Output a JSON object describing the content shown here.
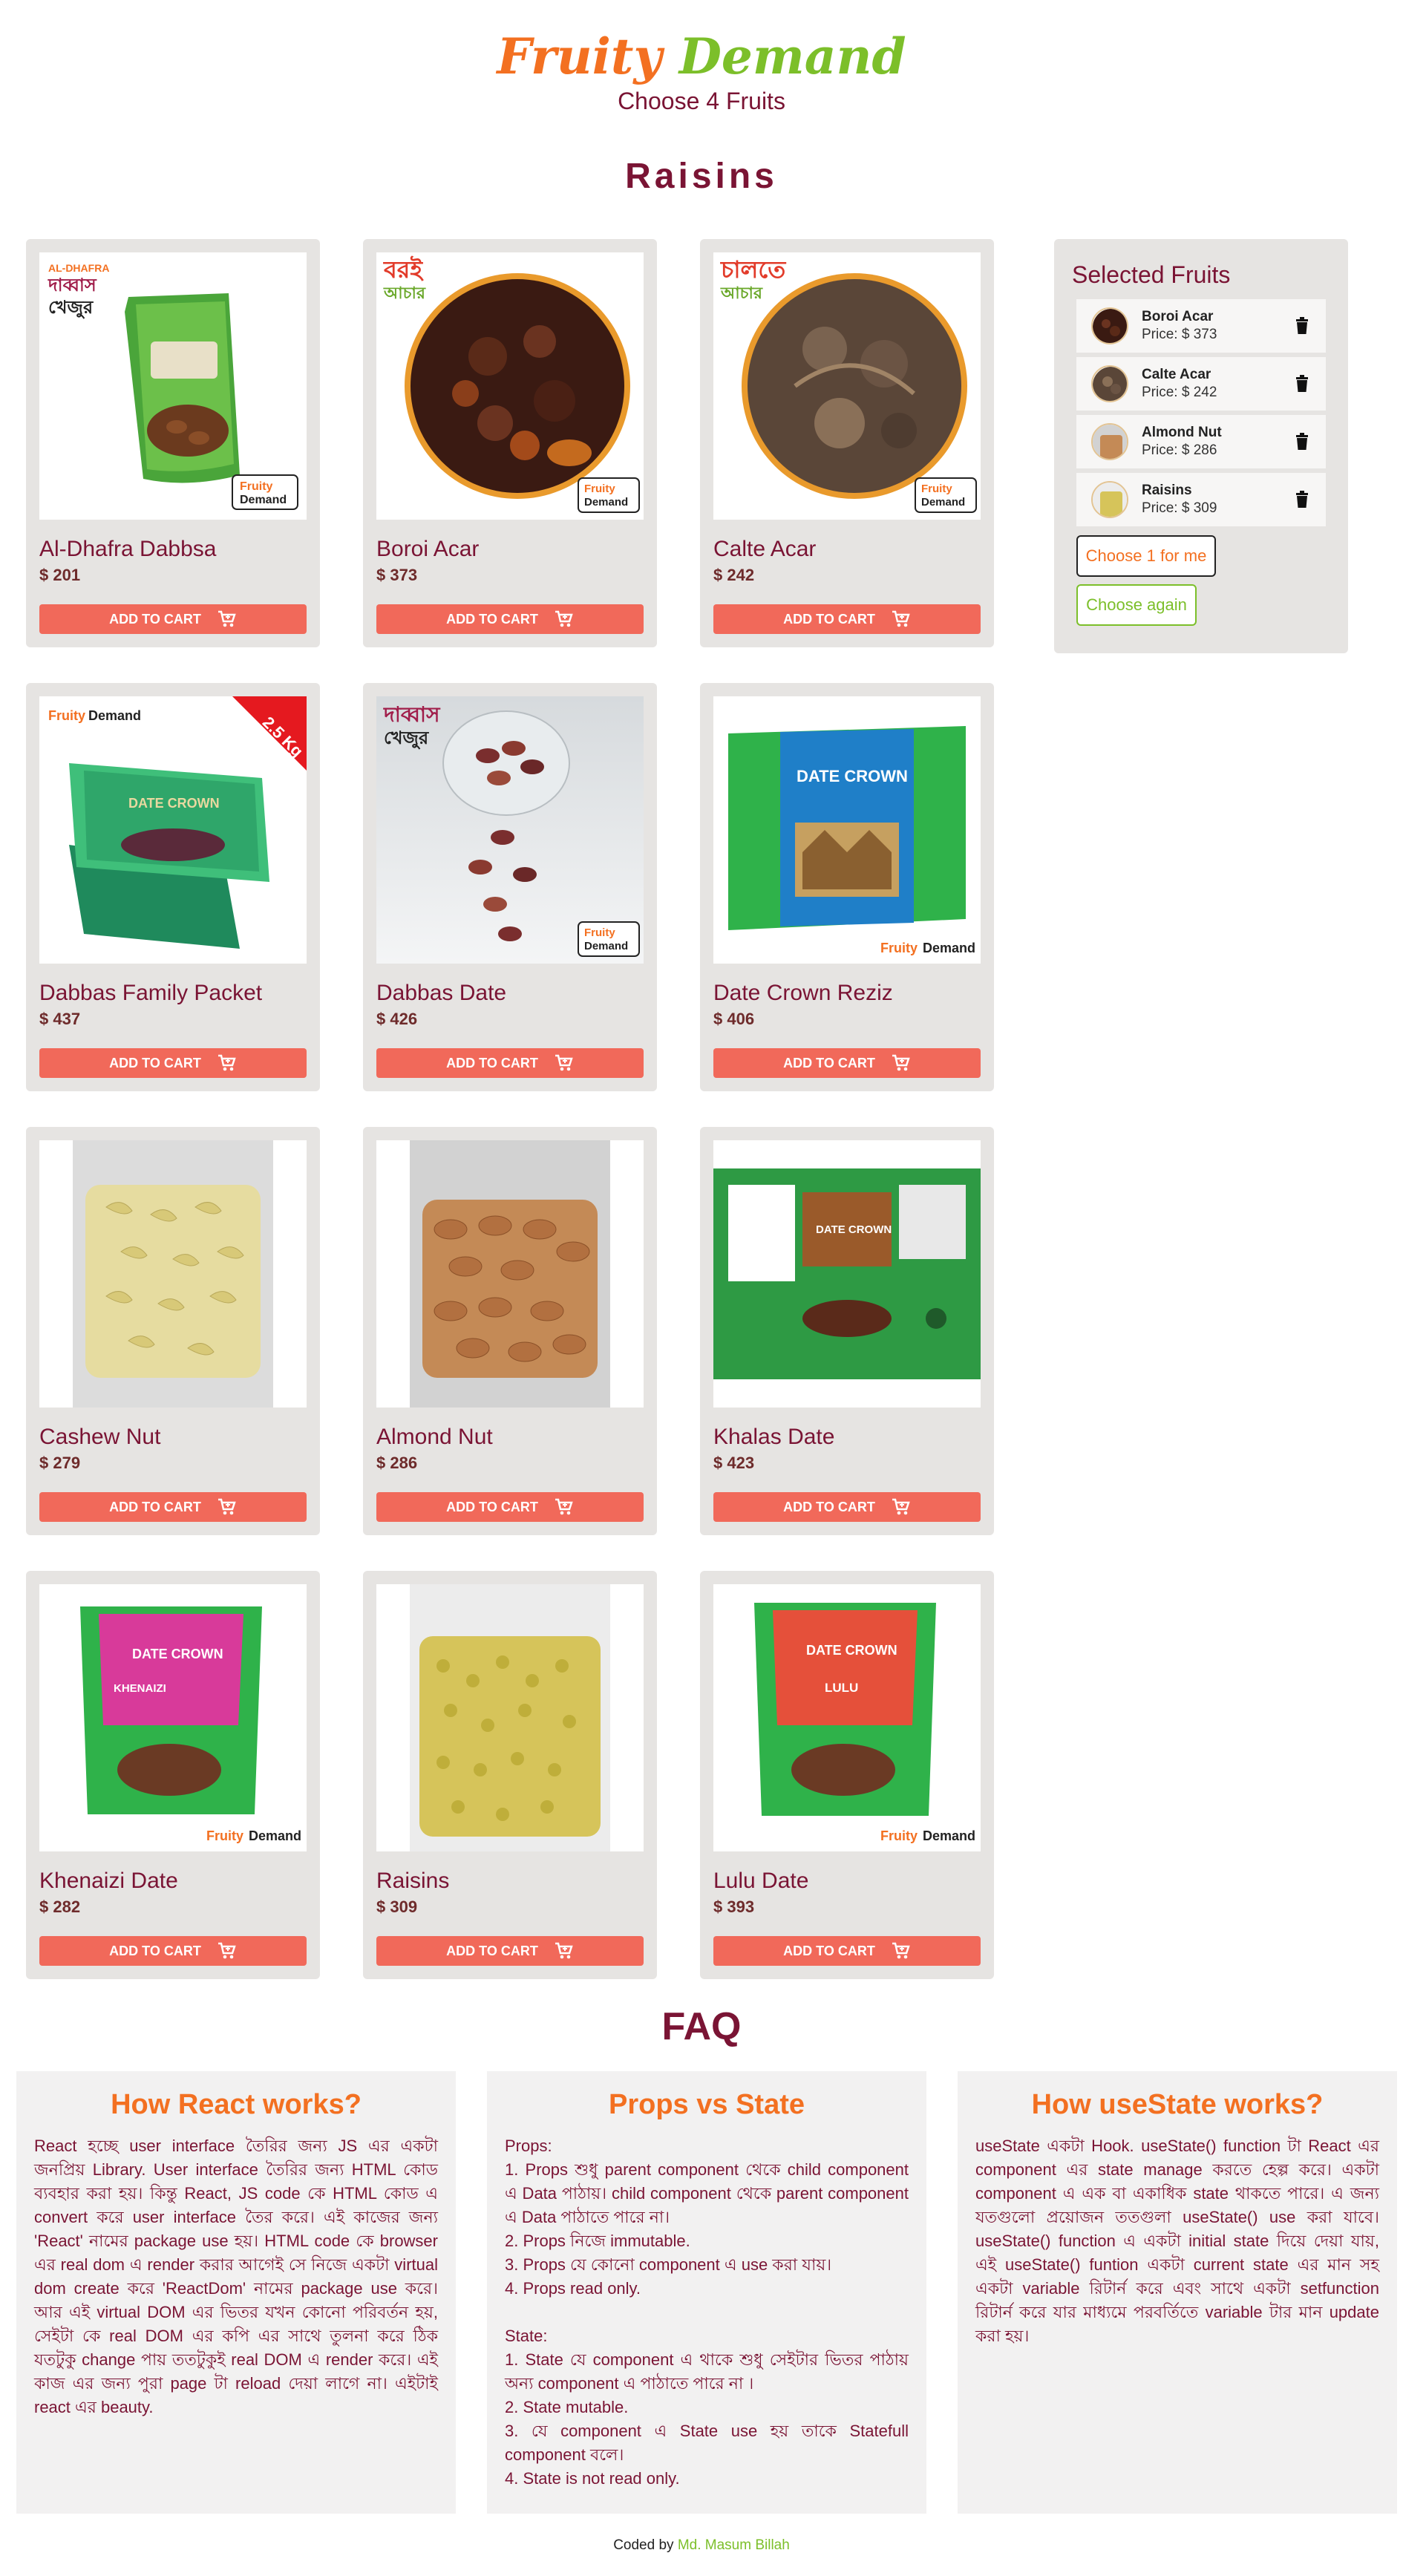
{
  "brand": {
    "word1": "Fruity",
    "word2": "Demand"
  },
  "subtitle": "Choose 4 Fruits",
  "category_title": "Raisins",
  "add_to_cart_label": "ADD TO CART",
  "products": [
    {
      "name": "Al-Dhafra Dabbsa",
      "price": "$ 201"
    },
    {
      "name": "Boroi Acar",
      "price": "$ 373"
    },
    {
      "name": "Calte Acar",
      "price": "$ 242"
    },
    {
      "name": "Dabbas Family Packet",
      "price": "$ 437"
    },
    {
      "name": "Dabbas Date",
      "price": "$ 426"
    },
    {
      "name": "Date Crown Reziz",
      "price": "$ 406"
    },
    {
      "name": "Cashew Nut",
      "price": "$ 279"
    },
    {
      "name": "Almond Nut",
      "price": "$ 286"
    },
    {
      "name": "Khalas Date",
      "price": "$ 423"
    },
    {
      "name": "Khenaizi Date",
      "price": "$ 282"
    },
    {
      "name": "Raisins",
      "price": "$ 309"
    },
    {
      "name": "Lulu Date",
      "price": "$ 393"
    }
  ],
  "image_labels": {
    "dhafra_brand": "AL-DHAFRA",
    "dabbas_bn": "দাব্বাস",
    "khejur_bn": "খেজুর",
    "boroi_bn": "বরই",
    "achar_bn": "আচার",
    "calte_bn": "চালতে",
    "fruity": "Fruity",
    "demand": "Demand",
    "weight_badge": "2.5 Kg",
    "date_crown": "DATE CROWN",
    "khenaizi": "KHENAIZI",
    "lulu": "LULU"
  },
  "selected": {
    "title": "Selected Fruits",
    "items": [
      {
        "name": "Boroi Acar",
        "price": "Price: $ 373"
      },
      {
        "name": "Calte Acar",
        "price": "Price: $ 242"
      },
      {
        "name": "Almond Nut",
        "price": "Price: $ 286"
      },
      {
        "name": "Raisins",
        "price": "Price: $ 309"
      }
    ],
    "choose_one_label": "Choose 1 for me",
    "choose_again_label": "Choose again"
  },
  "faq": {
    "title": "FAQ",
    "cards": [
      {
        "title": "How React works?",
        "body": "React হচ্ছে user interface তৈরির জন্য JS এর একটা জনপ্রিয় Library. User interface তৈরির জন্য HTML কোড ব্যবহার করা হয়। কিন্তু React, JS code কে HTML কোড এ convert করে user interface তৈর করে। এই কাজের জন্য 'React' নামের package use হয়। HTML code কে browser এর real dom এ render করার আগেই সে নিজে একটা virtual dom create করে 'ReactDom' নামের package use করে। আর এই virtual DOM এর ভিতর যখন কোনো পরিবর্তন হয়, সেইটা কে real DOM এর কপি এর সাথে তুলনা করে ঠিক যতটুকু change পায় ততটুকুই real DOM এ render করে। এই কাজ এর জন্য পুরা page টা reload দেয়া লাগে না। এইটাই react এর beauty."
      },
      {
        "title": "Props vs State",
        "body": "Props:\n1. Props শুধু parent component থেকে child component এ Data পাঠায়। child component থেকে parent component এ Data পাঠাতে পারে না।\n2. Props নিজে immutable.\n3. Props যে কোনো component এ use করা যায়।\n4. Props read only.\n\nState:\n1. State যে component এ থাকে শুধু সেইটার ভিতর পাঠায় অন্য component এ পাঠাতে পারে না ।\n2. State mutable.\n3. যে component এ State use হয় তাকে Statefull component বলে।\n4. State is not read only."
      },
      {
        "title": "How useState works?",
        "body": "useState একটা Hook. useState() function টা React এর component এর state manage করতে হেল্প করে। একটা component এ এক বা একাধিক state থাকতে পারে। এ জন্য যতগুলো প্রয়োজন ততগুলা useState() use করা যাবে। useState() function এ একটা initial state দিয়ে দেয়া যায়, এই useState() funtion একটা current state এর মান সহ একটা variable রিটার্ন করে এবং সাথে একটা setfunction রিটার্ন করে যার মাধ্যমে পরবর্তিতে variable টার মান update করা হয়।"
      }
    ]
  },
  "footer": {
    "prefix": "Coded by",
    "author": "Md. Masum Billah"
  },
  "colors": {
    "orange": "#f37021",
    "green": "#7cbf2a",
    "maroon": "#7a1434",
    "cart": "#f1695a",
    "card": "#e6e4e2"
  }
}
